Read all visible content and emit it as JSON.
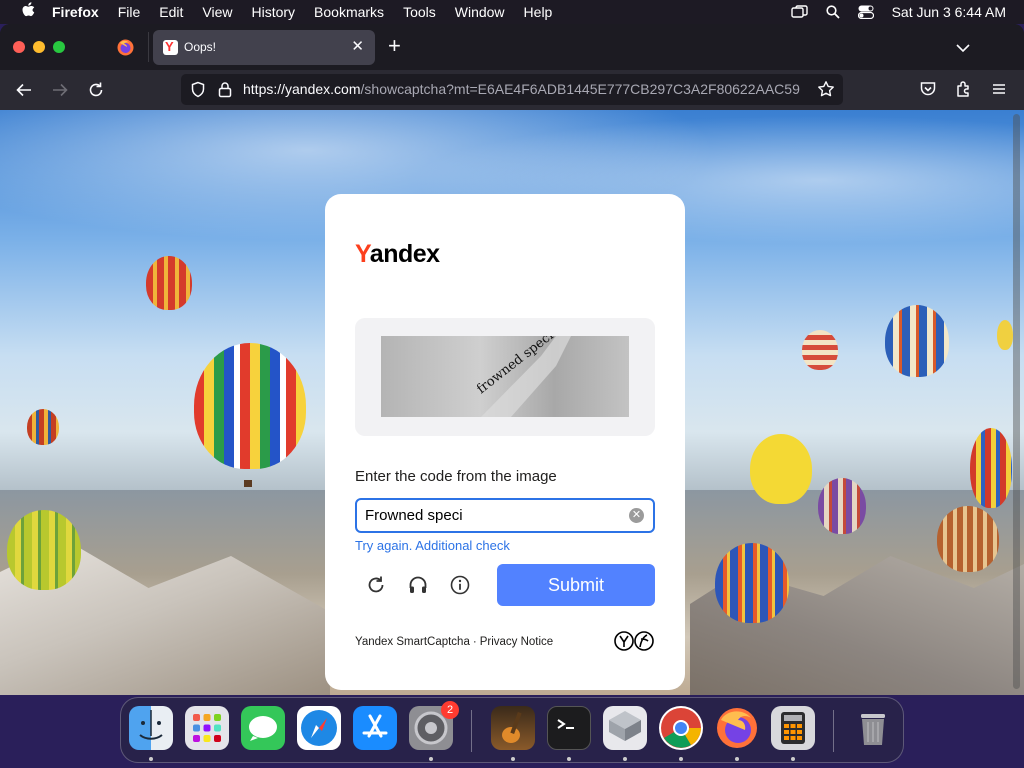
{
  "menubar": {
    "app_name": "Firefox",
    "items": [
      "File",
      "Edit",
      "View",
      "History",
      "Bookmarks",
      "Tools",
      "Window",
      "Help"
    ],
    "clock": "Sat Jun 3  6:44 AM"
  },
  "browser": {
    "tab_title": "Oops!",
    "url_domain": "https://yandex.com",
    "url_path": "/showcaptcha?mt=E6AE4F6ADB1445E777CB297C3A2F80622AAC59"
  },
  "captcha": {
    "brand": "Yandex",
    "captcha_text": "frowned specialist",
    "prompt": "Enter the code from the image",
    "input_value": "Frowned speci",
    "error_text": "Try again. Additional check",
    "submit_label": "Submit",
    "footer_brand": "Yandex SmartCaptcha",
    "footer_separator": "·",
    "footer_privacy": "Privacy Notice"
  },
  "dock": {
    "settings_badge": "2"
  },
  "icons": [
    "apple-icon",
    "screen-mirroring-icon",
    "spotlight-search-icon",
    "control-center-icon",
    "back-icon",
    "forward-icon",
    "reload-icon",
    "shield-icon",
    "lock-icon",
    "bookmark-star-icon",
    "pocket-icon",
    "extensions-icon",
    "hamburger-menu-icon",
    "refresh-captcha-icon",
    "audio-captcha-icon",
    "info-icon"
  ],
  "colors": {
    "yandex_red": "#fc3f1d",
    "submit_blue": "#5282ff",
    "link_blue": "#2c73e6"
  }
}
